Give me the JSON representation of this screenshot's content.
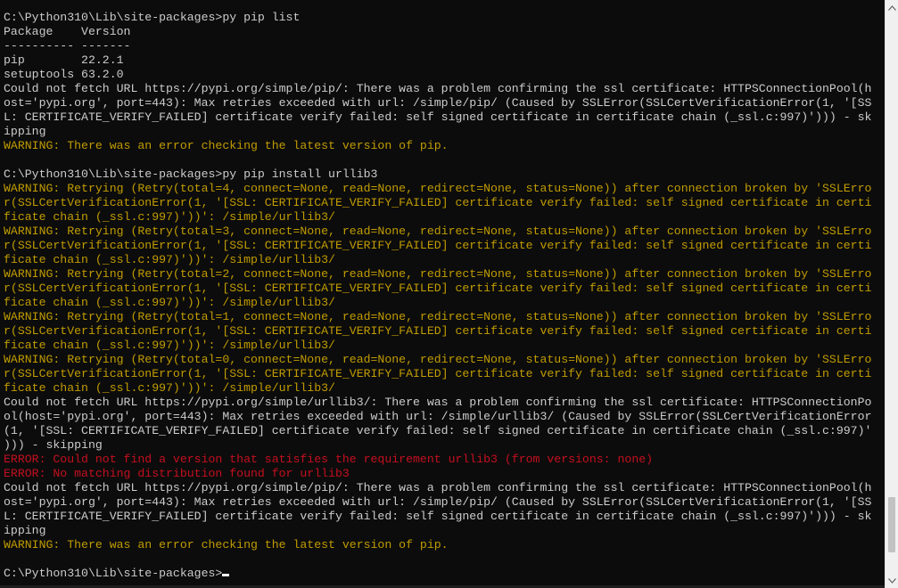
{
  "colors": {
    "background": "#0c0c0c",
    "normal": "#cccccc",
    "warning": "#c19c00",
    "error": "#c50f1f",
    "scrollbar_bg": "#f0f0f0",
    "scrollbar_thumb": "#c2c2c2"
  },
  "scrollbar": {
    "up_icon": "chevron-up-icon",
    "down_icon": "chevron-down-icon",
    "thumb_position": 0.96,
    "thumb_fraction": 0.1
  },
  "lines": [
    {
      "text": "C:\\Python310\\Lib\\site-packages>py pip list",
      "type": "normal"
    },
    {
      "text": "Package    Version",
      "type": "normal"
    },
    {
      "text": "---------- -------",
      "type": "normal"
    },
    {
      "text": "pip        22.2.1",
      "type": "normal"
    },
    {
      "text": "setuptools 63.2.0",
      "type": "normal"
    },
    {
      "text": "Could not fetch URL https://pypi.org/simple/pip/: There was a problem confirming the ssl certificate: HTTPSConnectionPool(h",
      "type": "normal"
    },
    {
      "text": "ost='pypi.org', port=443): Max retries exceeded with url: /simple/pip/ (Caused by SSLError(SSLCertVerificationError(1, '[SS",
      "type": "normal"
    },
    {
      "text": "L: CERTIFICATE_VERIFY_FAILED] certificate verify failed: self signed certificate in certificate chain (_ssl.c:997)'))) - sk",
      "type": "normal"
    },
    {
      "text": "ipping",
      "type": "normal"
    },
    {
      "text": "WARNING: There was an error checking the latest version of pip.",
      "type": "warning"
    },
    {
      "text": "",
      "type": "normal"
    },
    {
      "text": "C:\\Python310\\Lib\\site-packages>py pip install urllib3",
      "type": "normal"
    },
    {
      "text": "WARNING: Retrying (Retry(total=4, connect=None, read=None, redirect=None, status=None)) after connection broken by 'SSLErro",
      "type": "warning"
    },
    {
      "text": "r(SSLCertVerificationError(1, '[SSL: CERTIFICATE_VERIFY_FAILED] certificate verify failed: self signed certificate in certi",
      "type": "warning"
    },
    {
      "text": "ficate chain (_ssl.c:997)'))': /simple/urllib3/",
      "type": "warning"
    },
    {
      "text": "WARNING: Retrying (Retry(total=3, connect=None, read=None, redirect=None, status=None)) after connection broken by 'SSLErro",
      "type": "warning"
    },
    {
      "text": "r(SSLCertVerificationError(1, '[SSL: CERTIFICATE_VERIFY_FAILED] certificate verify failed: self signed certificate in certi",
      "type": "warning"
    },
    {
      "text": "ficate chain (_ssl.c:997)'))': /simple/urllib3/",
      "type": "warning"
    },
    {
      "text": "WARNING: Retrying (Retry(total=2, connect=None, read=None, redirect=None, status=None)) after connection broken by 'SSLErro",
      "type": "warning"
    },
    {
      "text": "r(SSLCertVerificationError(1, '[SSL: CERTIFICATE_VERIFY_FAILED] certificate verify failed: self signed certificate in certi",
      "type": "warning"
    },
    {
      "text": "ficate chain (_ssl.c:997)'))': /simple/urllib3/",
      "type": "warning"
    },
    {
      "text": "WARNING: Retrying (Retry(total=1, connect=None, read=None, redirect=None, status=None)) after connection broken by 'SSLErro",
      "type": "warning"
    },
    {
      "text": "r(SSLCertVerificationError(1, '[SSL: CERTIFICATE_VERIFY_FAILED] certificate verify failed: self signed certificate in certi",
      "type": "warning"
    },
    {
      "text": "ficate chain (_ssl.c:997)'))': /simple/urllib3/",
      "type": "warning"
    },
    {
      "text": "WARNING: Retrying (Retry(total=0, connect=None, read=None, redirect=None, status=None)) after connection broken by 'SSLErro",
      "type": "warning"
    },
    {
      "text": "r(SSLCertVerificationError(1, '[SSL: CERTIFICATE_VERIFY_FAILED] certificate verify failed: self signed certificate in certi",
      "type": "warning"
    },
    {
      "text": "ficate chain (_ssl.c:997)'))': /simple/urllib3/",
      "type": "warning"
    },
    {
      "text": "Could not fetch URL https://pypi.org/simple/urllib3/: There was a problem confirming the ssl certificate: HTTPSConnectionPo",
      "type": "normal"
    },
    {
      "text": "ol(host='pypi.org', port=443): Max retries exceeded with url: /simple/urllib3/ (Caused by SSLError(SSLCertVerificationError",
      "type": "normal"
    },
    {
      "text": "(1, '[SSL: CERTIFICATE_VERIFY_FAILED] certificate verify failed: self signed certificate in certificate chain (_ssl.c:997)'",
      "type": "normal"
    },
    {
      "text": "))) - skipping",
      "type": "normal"
    },
    {
      "text": "ERROR: Could not find a version that satisfies the requirement urllib3 (from versions: none)",
      "type": "error"
    },
    {
      "text": "ERROR: No matching distribution found for urllib3",
      "type": "error"
    },
    {
      "text": "Could not fetch URL https://pypi.org/simple/pip/: There was a problem confirming the ssl certificate: HTTPSConnectionPool(h",
      "type": "normal"
    },
    {
      "text": "ost='pypi.org', port=443): Max retries exceeded with url: /simple/pip/ (Caused by SSLError(SSLCertVerificationError(1, '[SS",
      "type": "normal"
    },
    {
      "text": "L: CERTIFICATE_VERIFY_FAILED] certificate verify failed: self signed certificate in certificate chain (_ssl.c:997)'))) - sk",
      "type": "normal"
    },
    {
      "text": "ipping",
      "type": "normal"
    },
    {
      "text": "WARNING: There was an error checking the latest version of pip.",
      "type": "warning"
    },
    {
      "text": "",
      "type": "normal"
    }
  ],
  "prompt": "C:\\Python310\\Lib\\site-packages>"
}
